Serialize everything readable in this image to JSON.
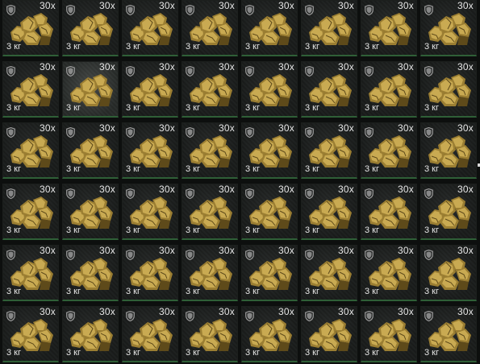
{
  "inventory": {
    "columns": 8,
    "rows": 6,
    "highlighted_slot_index": 9,
    "colors": {
      "gold_light": "#c9aa52",
      "gold_mid": "#9b7e32",
      "gold_dark": "#5e4a1a",
      "slot_border_accent": "#2f5f37",
      "text": "#e6e6e6",
      "shield": "#9a9a9a"
    },
    "item": {
      "icon": "gold-nugget-pile-icon",
      "badge_icon": "shield-icon"
    },
    "slots": [
      {
        "count": "30x",
        "weight": "3 кг"
      },
      {
        "count": "30x",
        "weight": "3 кг"
      },
      {
        "count": "30x",
        "weight": "3 кг"
      },
      {
        "count": "30x",
        "weight": "3 кг"
      },
      {
        "count": "30x",
        "weight": "3 кг"
      },
      {
        "count": "30x",
        "weight": "3 кг"
      },
      {
        "count": "30x",
        "weight": "3 кг"
      },
      {
        "count": "30x",
        "weight": "3 кг"
      },
      {
        "count": "30x",
        "weight": "3 кг"
      },
      {
        "count": "30x",
        "weight": "3 кг"
      },
      {
        "count": "30x",
        "weight": "3 кг"
      },
      {
        "count": "30x",
        "weight": "3 кг"
      },
      {
        "count": "30x",
        "weight": "3 кг"
      },
      {
        "count": "30x",
        "weight": "3 кг"
      },
      {
        "count": "30x",
        "weight": "3 кг"
      },
      {
        "count": "30x",
        "weight": "3 кг"
      },
      {
        "count": "30x",
        "weight": "3 кг"
      },
      {
        "count": "30x",
        "weight": "3 кг"
      },
      {
        "count": "30x",
        "weight": "3 кг"
      },
      {
        "count": "30x",
        "weight": "3 кг"
      },
      {
        "count": "30x",
        "weight": "3 кг"
      },
      {
        "count": "30x",
        "weight": "3 кг"
      },
      {
        "count": "30x",
        "weight": "3 кг"
      },
      {
        "count": "30x",
        "weight": "3 кг"
      },
      {
        "count": "30x",
        "weight": "3 кг"
      },
      {
        "count": "30x",
        "weight": "3 кг"
      },
      {
        "count": "30x",
        "weight": "3 кг"
      },
      {
        "count": "30x",
        "weight": "3 кг"
      },
      {
        "count": "30x",
        "weight": "3 кг"
      },
      {
        "count": "30x",
        "weight": "3 кг"
      },
      {
        "count": "30x",
        "weight": "3 кг"
      },
      {
        "count": "30x",
        "weight": "3 кг"
      },
      {
        "count": "30x",
        "weight": "3 кг"
      },
      {
        "count": "30x",
        "weight": "3 кг"
      },
      {
        "count": "30x",
        "weight": "3 кг"
      },
      {
        "count": "30x",
        "weight": "3 кг"
      },
      {
        "count": "30x",
        "weight": "3 кг"
      },
      {
        "count": "30x",
        "weight": "3 кг"
      },
      {
        "count": "30x",
        "weight": "3 кг"
      },
      {
        "count": "30x",
        "weight": "3 кг"
      },
      {
        "count": "30x",
        "weight": "3 кг"
      },
      {
        "count": "30x",
        "weight": "3 кг"
      },
      {
        "count": "30x",
        "weight": "3 кг"
      },
      {
        "count": "30x",
        "weight": "3 кг"
      },
      {
        "count": "30x",
        "weight": "3 кг"
      },
      {
        "count": "30x",
        "weight": "3 кг"
      },
      {
        "count": "30x",
        "weight": "3 кг"
      },
      {
        "count": "30x",
        "weight": "3 кг"
      }
    ]
  }
}
